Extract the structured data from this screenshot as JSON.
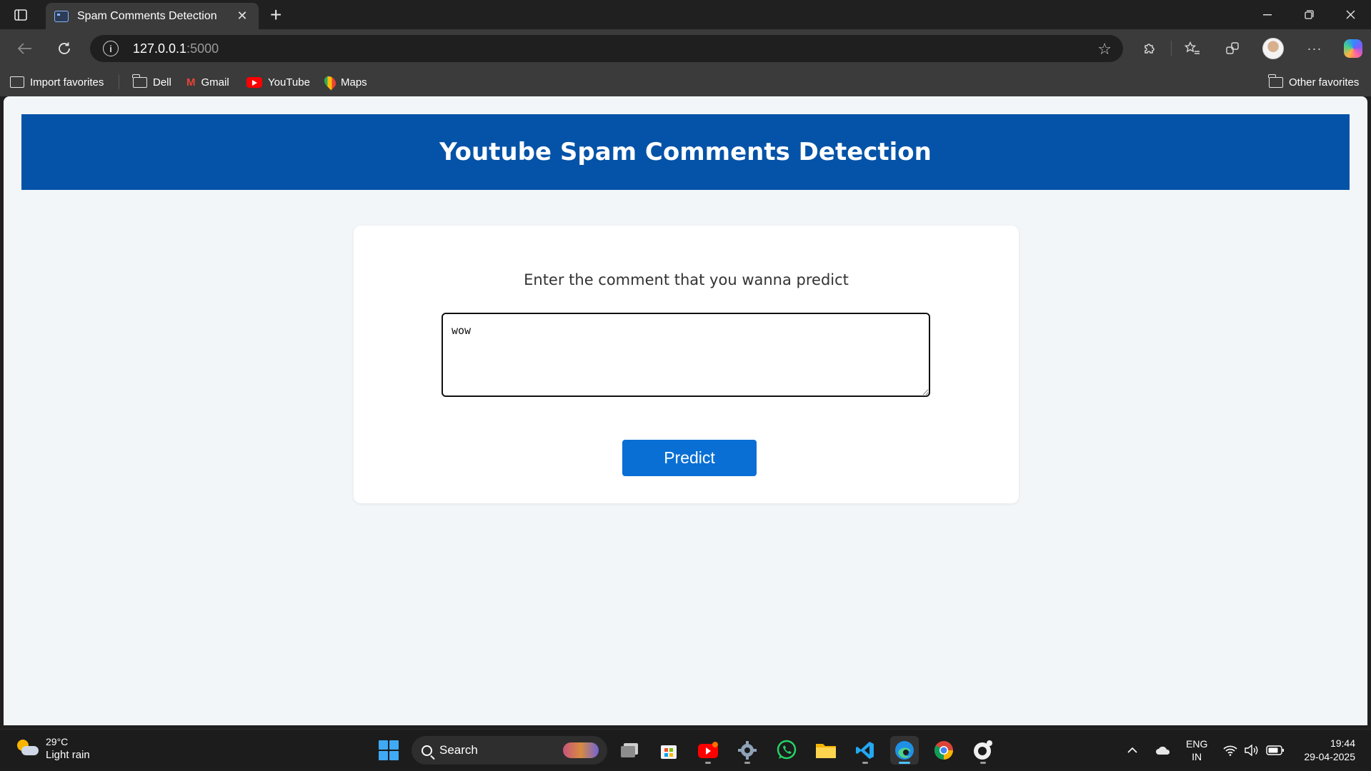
{
  "browser": {
    "tab_title": "Spam Comments Detection",
    "url_host": "127.0.0.1",
    "url_port": ":5000",
    "favorites": {
      "import_label": "Import favorites",
      "dell_label": "Dell",
      "gmail_label": "Gmail",
      "youtube_label": "YouTube",
      "maps_label": "Maps",
      "other_label": "Other favorites"
    }
  },
  "page": {
    "banner_title": "Youtube Spam Comments Detection",
    "prompt": "Enter the comment that you wanna predict",
    "comment_value": "wow",
    "predict_label": "Predict",
    "colors": {
      "banner": "#0453a8",
      "button": "#0a6fd4",
      "background": "#f3f6f9"
    }
  },
  "taskbar": {
    "weather_temp": "29°C",
    "weather_desc": "Light rain",
    "search_label": "Search",
    "lang_top": "ENG",
    "lang_bottom": "IN",
    "time": "19:44",
    "date": "29-04-2025"
  }
}
